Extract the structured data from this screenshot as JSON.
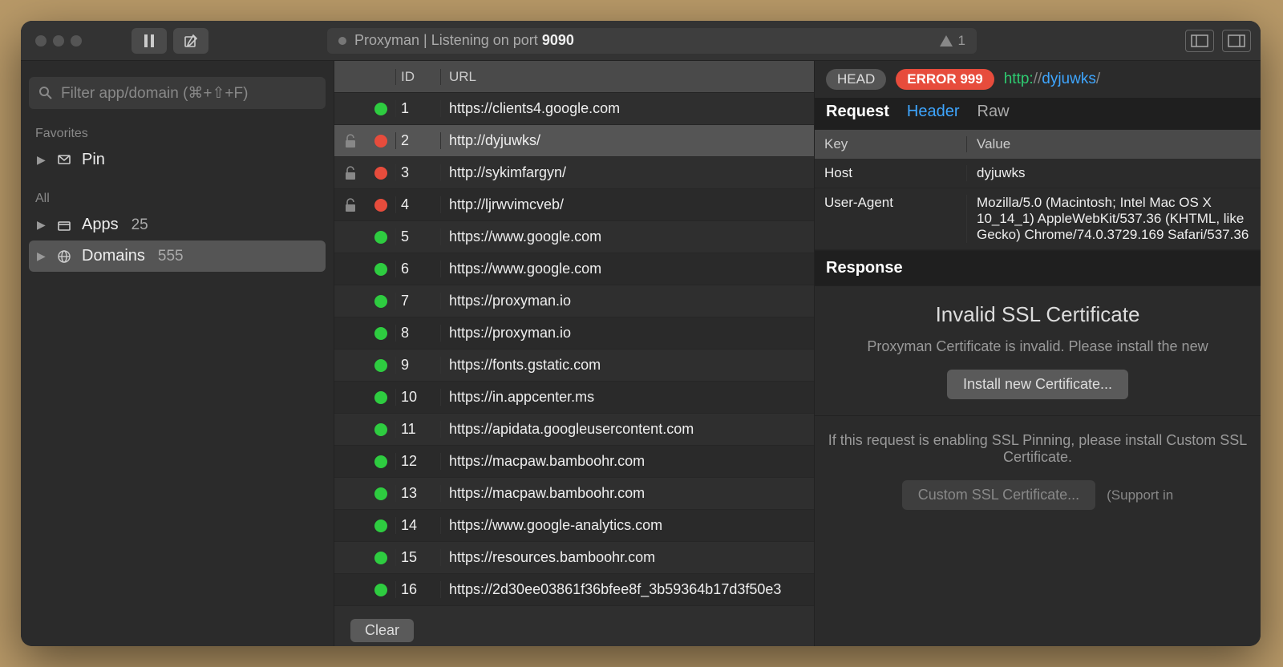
{
  "toolbar": {
    "title_prefix": "Proxyman | Listening on port ",
    "port": "9090",
    "warn_count": "1"
  },
  "sidebar": {
    "filter_placeholder": "Filter app/domain (⌘+⇧+F)",
    "section_favorites": "Favorites",
    "section_all": "All",
    "favorites": [
      {
        "label": "Pin",
        "icon": "pin"
      }
    ],
    "all": [
      {
        "label": "Apps",
        "count": "25",
        "icon": "apps"
      },
      {
        "label": "Domains",
        "count": "555",
        "icon": "domains",
        "selected": true
      }
    ]
  },
  "table": {
    "col_id": "ID",
    "col_url": "URL",
    "clear_label": "Clear",
    "rows": [
      {
        "id": "1",
        "url": "https://clients4.google.com",
        "status": "green",
        "lock": false
      },
      {
        "id": "2",
        "url": "http://dyjuwks/",
        "status": "red",
        "lock": true,
        "selected": true
      },
      {
        "id": "3",
        "url": "http://sykimfargyn/",
        "status": "red",
        "lock": true
      },
      {
        "id": "4",
        "url": "http://ljrwvimcveb/",
        "status": "red",
        "lock": true
      },
      {
        "id": "5",
        "url": "https://www.google.com",
        "status": "green",
        "lock": false
      },
      {
        "id": "6",
        "url": "https://www.google.com",
        "status": "green",
        "lock": false
      },
      {
        "id": "7",
        "url": "https://proxyman.io",
        "status": "green",
        "lock": false
      },
      {
        "id": "8",
        "url": "https://proxyman.io",
        "status": "green",
        "lock": false
      },
      {
        "id": "9",
        "url": "https://fonts.gstatic.com",
        "status": "green",
        "lock": false
      },
      {
        "id": "10",
        "url": "https://in.appcenter.ms",
        "status": "green",
        "lock": false
      },
      {
        "id": "11",
        "url": "https://apidata.googleusercontent.com",
        "status": "green",
        "lock": false
      },
      {
        "id": "12",
        "url": "https://macpaw.bamboohr.com",
        "status": "green",
        "lock": false
      },
      {
        "id": "13",
        "url": "https://macpaw.bamboohr.com",
        "status": "green",
        "lock": false
      },
      {
        "id": "14",
        "url": "https://www.google-analytics.com",
        "status": "green",
        "lock": false
      },
      {
        "id": "15",
        "url": "https://resources.bamboohr.com",
        "status": "green",
        "lock": false
      },
      {
        "id": "16",
        "url": "https://2d30ee03861f36bfee8f_3b59364b17d3f50e3",
        "status": "green",
        "lock": false
      }
    ]
  },
  "detail": {
    "method": "HEAD",
    "error": "ERROR 999",
    "url_scheme": "http:",
    "url_sep": "//",
    "url_host": "dyjuwks",
    "url_path": "/",
    "tabs": {
      "request": "Request",
      "header": "Header",
      "raw": "Raw"
    },
    "kv_head_key": "Key",
    "kv_head_value": "Value",
    "headers": [
      {
        "key": "Host",
        "value": "dyjuwks"
      },
      {
        "key": "User-Agent",
        "value": "Mozilla/5.0 (Macintosh; Intel Mac OS X 10_14_1) AppleWebKit/537.36 (KHTML, like Gecko) Chrome/74.0.3729.169 Safari/537.36"
      }
    ],
    "response_label": "Response",
    "ssl_title": "Invalid SSL Certificate",
    "ssl_body": "Proxyman Certificate is invalid. Please install the new",
    "ssl_button": "Install new Certificate...",
    "pin_body": "If this request is enabling SSL Pinning, please install Custom SSL Certificate.",
    "pin_button": "Custom SSL Certificate...",
    "pin_note": "(Support in"
  }
}
